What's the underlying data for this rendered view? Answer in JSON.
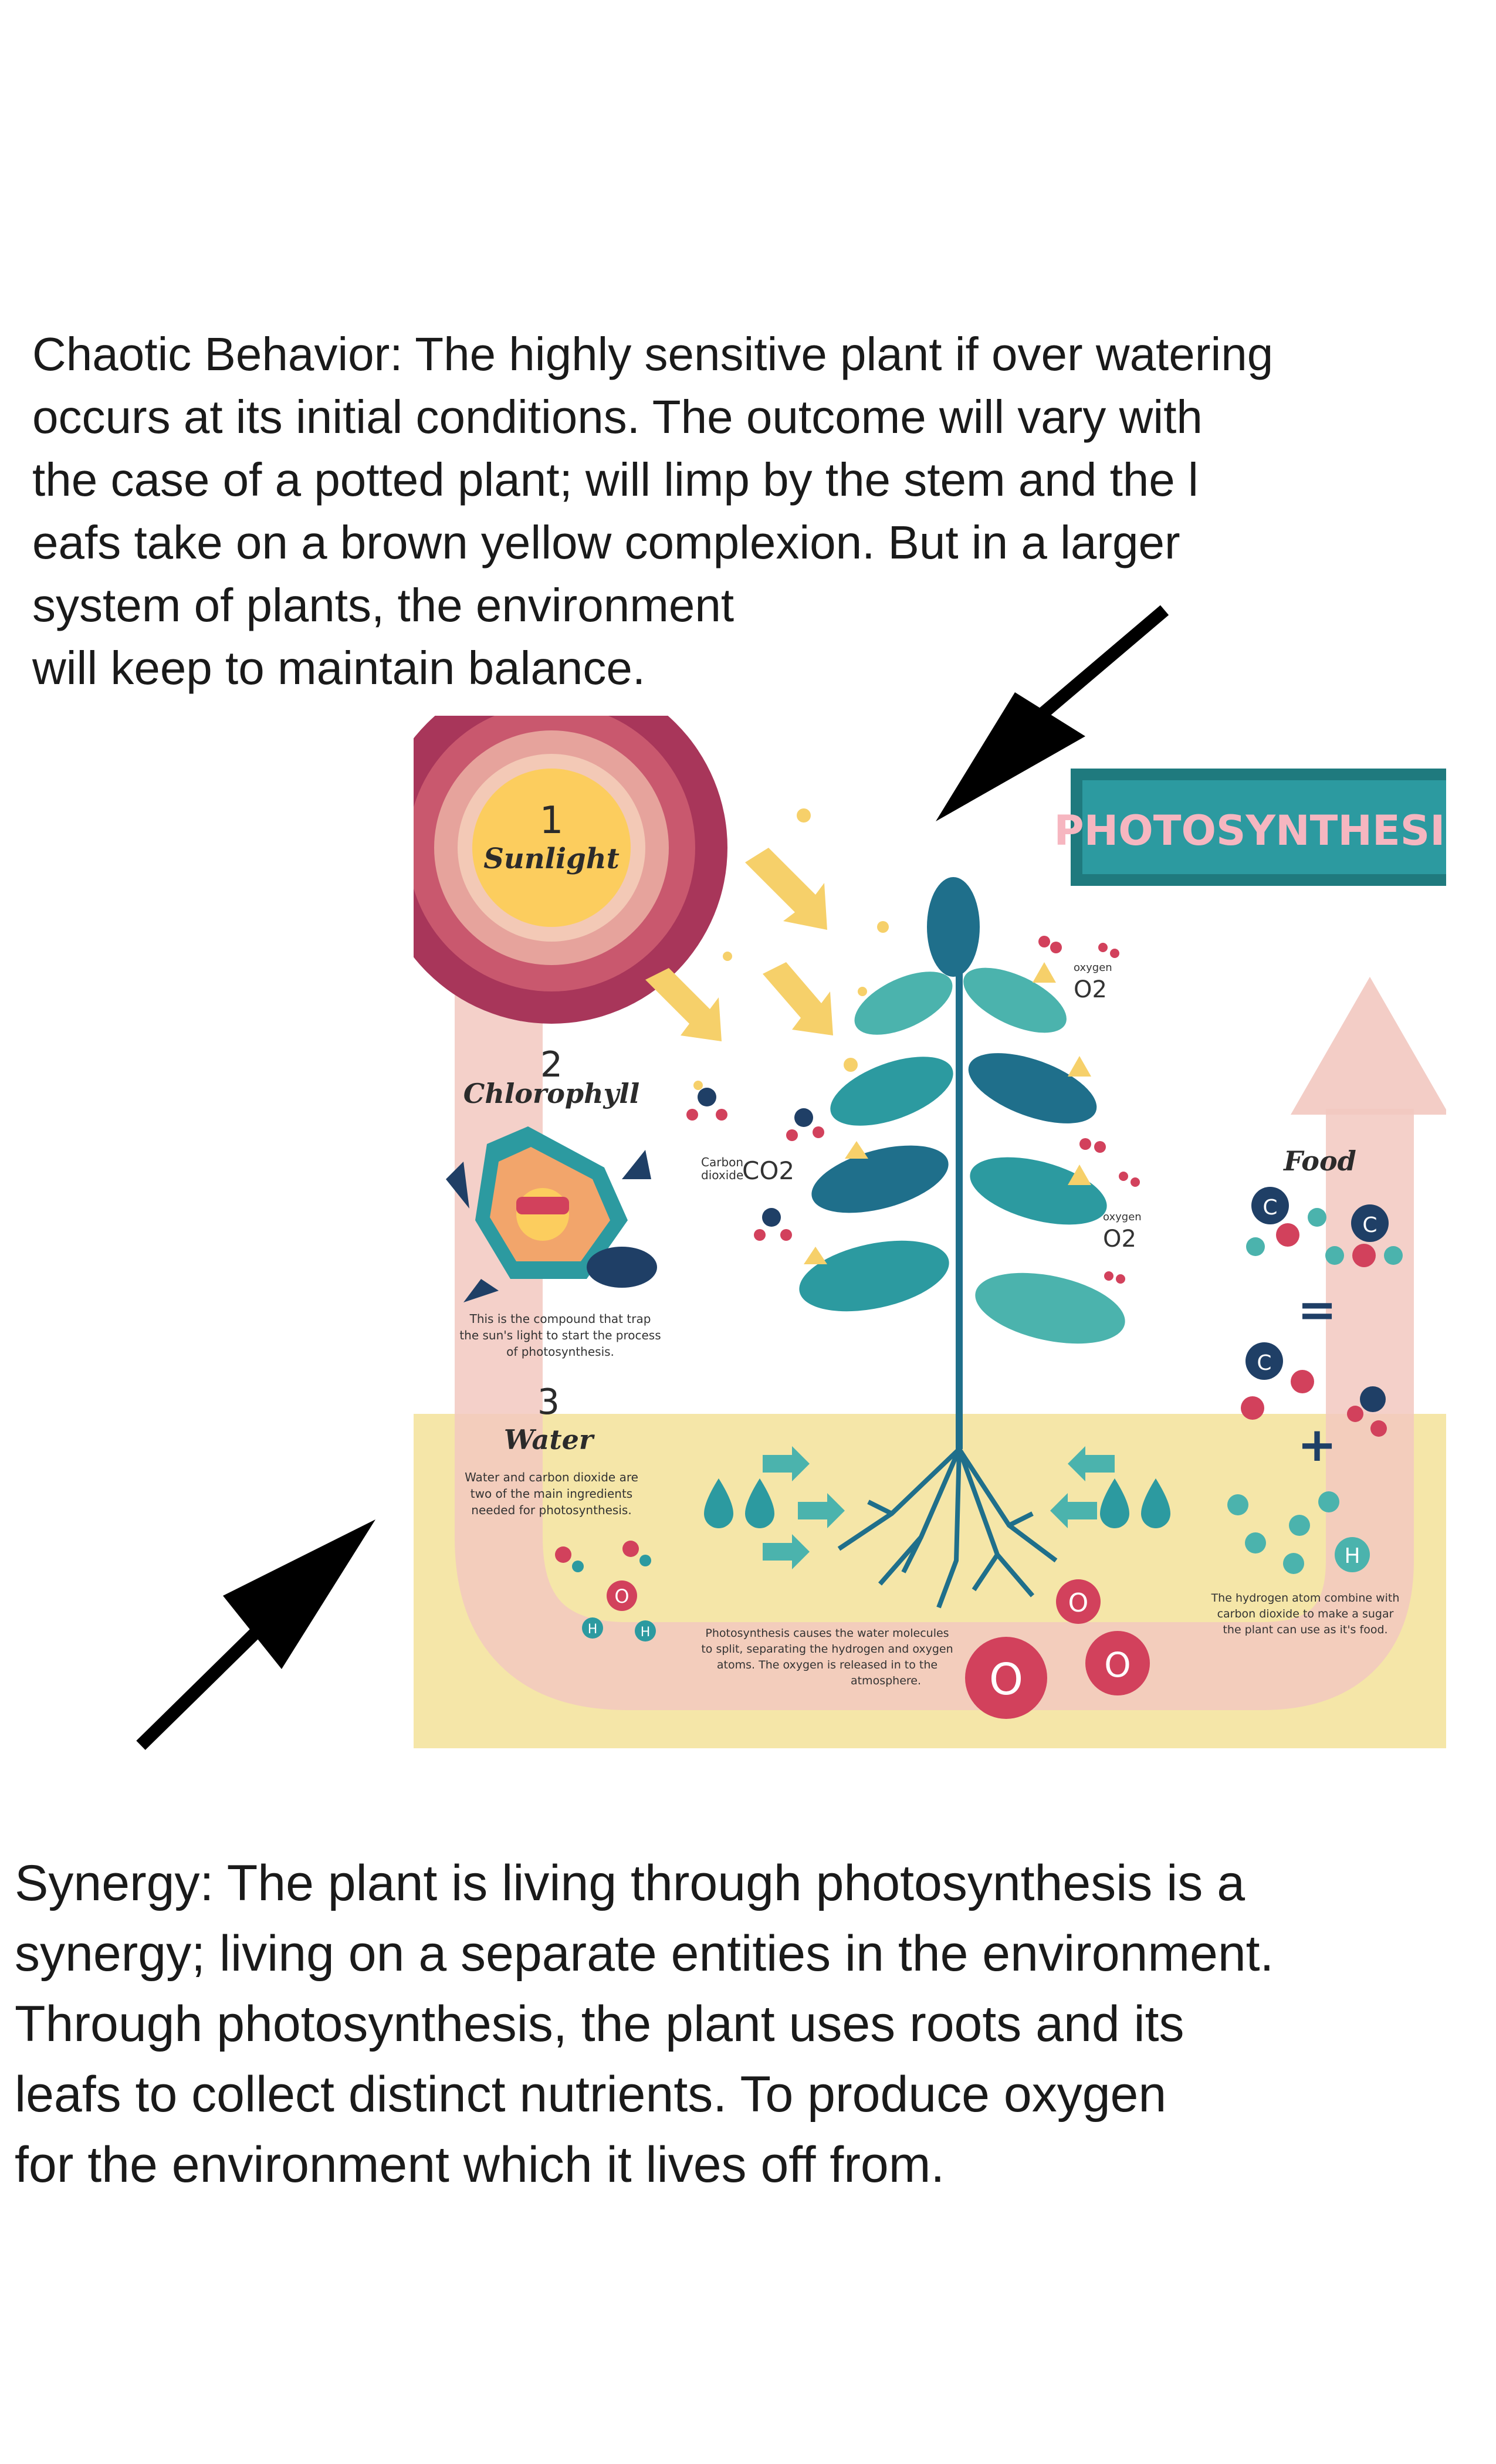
{
  "chaotic_lines": [
    "Chaotic Behavior: The highly sensitive plant if over watering",
    "occurs at its initial conditions. The outcome will vary with",
    " the case of a potted plant; will limp by the stem and the l",
    "eafs take on a brown yellow complexion. But in a larger",
    " system of plants, the environment",
    "will keep to maintain balance."
  ],
  "synergy_lines": [
    "Synergy: The plant is living through photosynthesis is a",
    "synergy; living on a separate entities in the environment.",
    "Through photosynthesis, the plant uses roots and its",
    "leafs to collect distinct nutrients. To produce oxygen",
    "for the environment which it lives off from."
  ],
  "infographic": {
    "title": "PHOTOSYNTHESIS",
    "step1_num": "1",
    "step1_label": "Sunlight",
    "step2_num": "2",
    "step2_label": "Chlorophyll",
    "step2_desc": [
      "This is the compound that trap",
      "the sun's light to start the process",
      "of photosynthesis."
    ],
    "step3_num": "3",
    "step3_label": "Water",
    "step3_desc": [
      "Water and carbon dioxide are",
      "two of the main ingredients",
      "needed for photosynthesis."
    ],
    "food_label": "Food",
    "co2_small": [
      "Carbon",
      "dioxide"
    ],
    "co2_big": "CO2",
    "oxygen_small": "oxygen",
    "oxygen_big": "O2",
    "equals": "=",
    "plus": "+",
    "split_desc": [
      "Photosynthesis causes the water molecules",
      "to split, separating the hydrogen and oxygen",
      "atoms. The oxygen is released in to the",
      "atmosphere."
    ],
    "hydrogen_desc": [
      "The hydrogen atom combine with",
      "carbon dioxide to make a sugar",
      "the plant can use as it's food."
    ],
    "atom_o": "O",
    "atom_h": "H",
    "atom_c": "C"
  },
  "colors": {
    "sun_outer": "#a8365a",
    "sun_ring2": "#c9586e",
    "sun_ring3": "#e6a39c",
    "sun_ring4": "#f3c9b6",
    "sun_core": "#fccd5e",
    "ground": "#f5e6a8",
    "pipe": "#f2c8c0",
    "teal": "#2c9aa0",
    "leaf_dark": "#1f6f8b",
    "leaf_light": "#4bb3ad",
    "molecule_red": "#d2415c",
    "arrow_black": "#000000"
  }
}
